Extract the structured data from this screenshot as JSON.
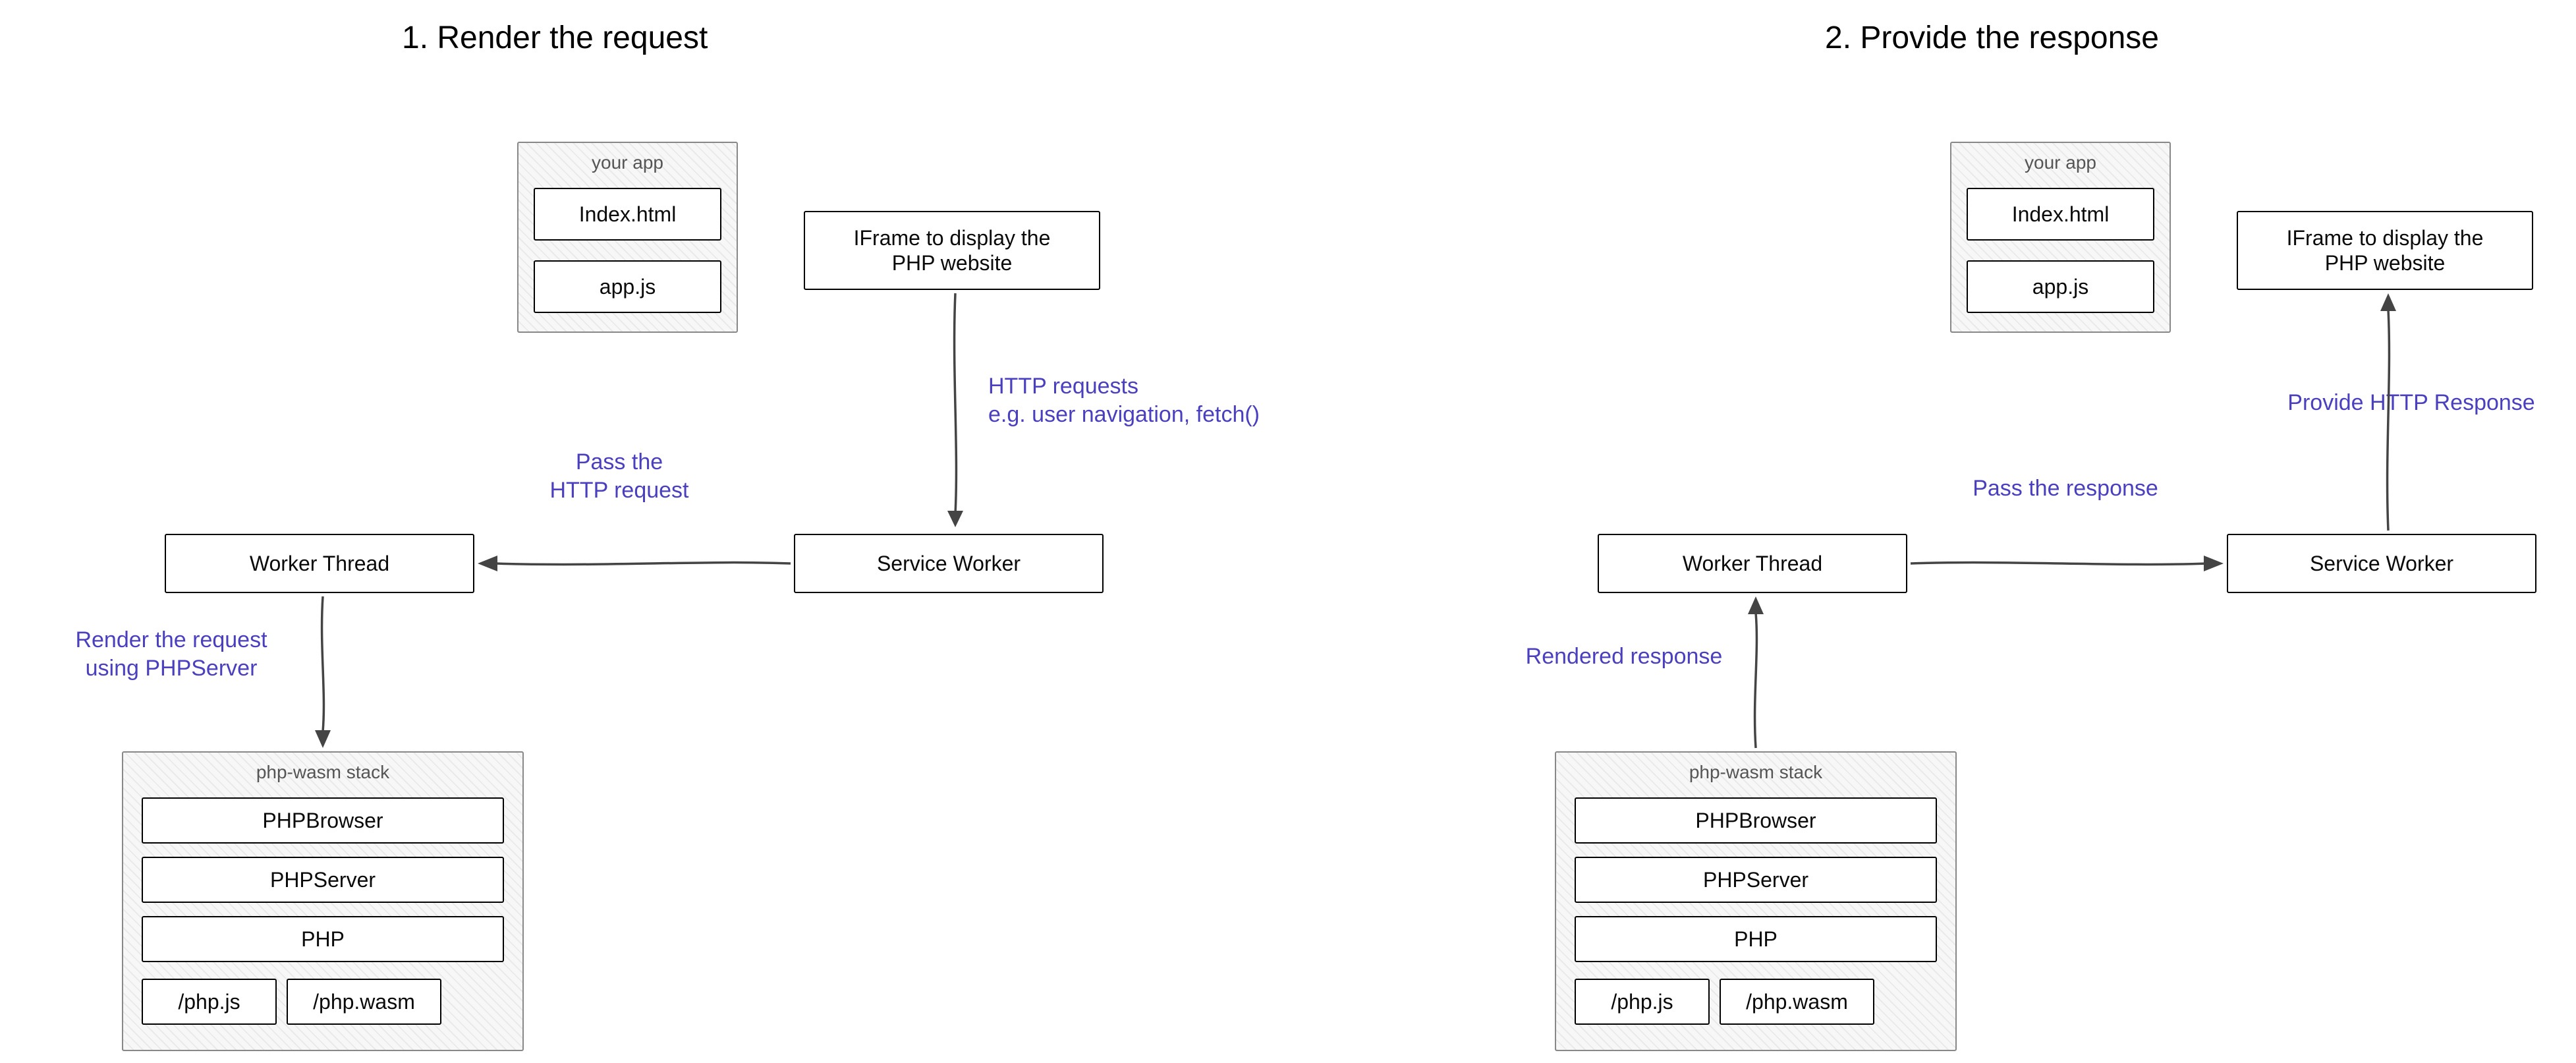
{
  "headings": {
    "left": "1. Render the request",
    "right": "2. Provide the response"
  },
  "app_group": {
    "title": "your app",
    "file1": "Index.html",
    "file2": "app.js"
  },
  "iframe_box": "IFrame to display the\nPHP website",
  "worker_thread": "Worker Thread",
  "service_worker": "Service Worker",
  "wasm_group": {
    "title": "php-wasm stack",
    "item1": "PHPBrowser",
    "item2": "PHPServer",
    "item3": "PHP",
    "item4a": "/php.js",
    "item4b": "/php.wasm"
  },
  "annotations": {
    "http_requests": "HTTP requests\ne.g. user navigation, fetch()",
    "pass_request": "Pass the\nHTTP request",
    "render_request": "Render the request\nusing PHPServer",
    "pass_response": "Pass the response",
    "rendered_response": "Rendered response",
    "provide_response": "Provide HTTP Response"
  }
}
